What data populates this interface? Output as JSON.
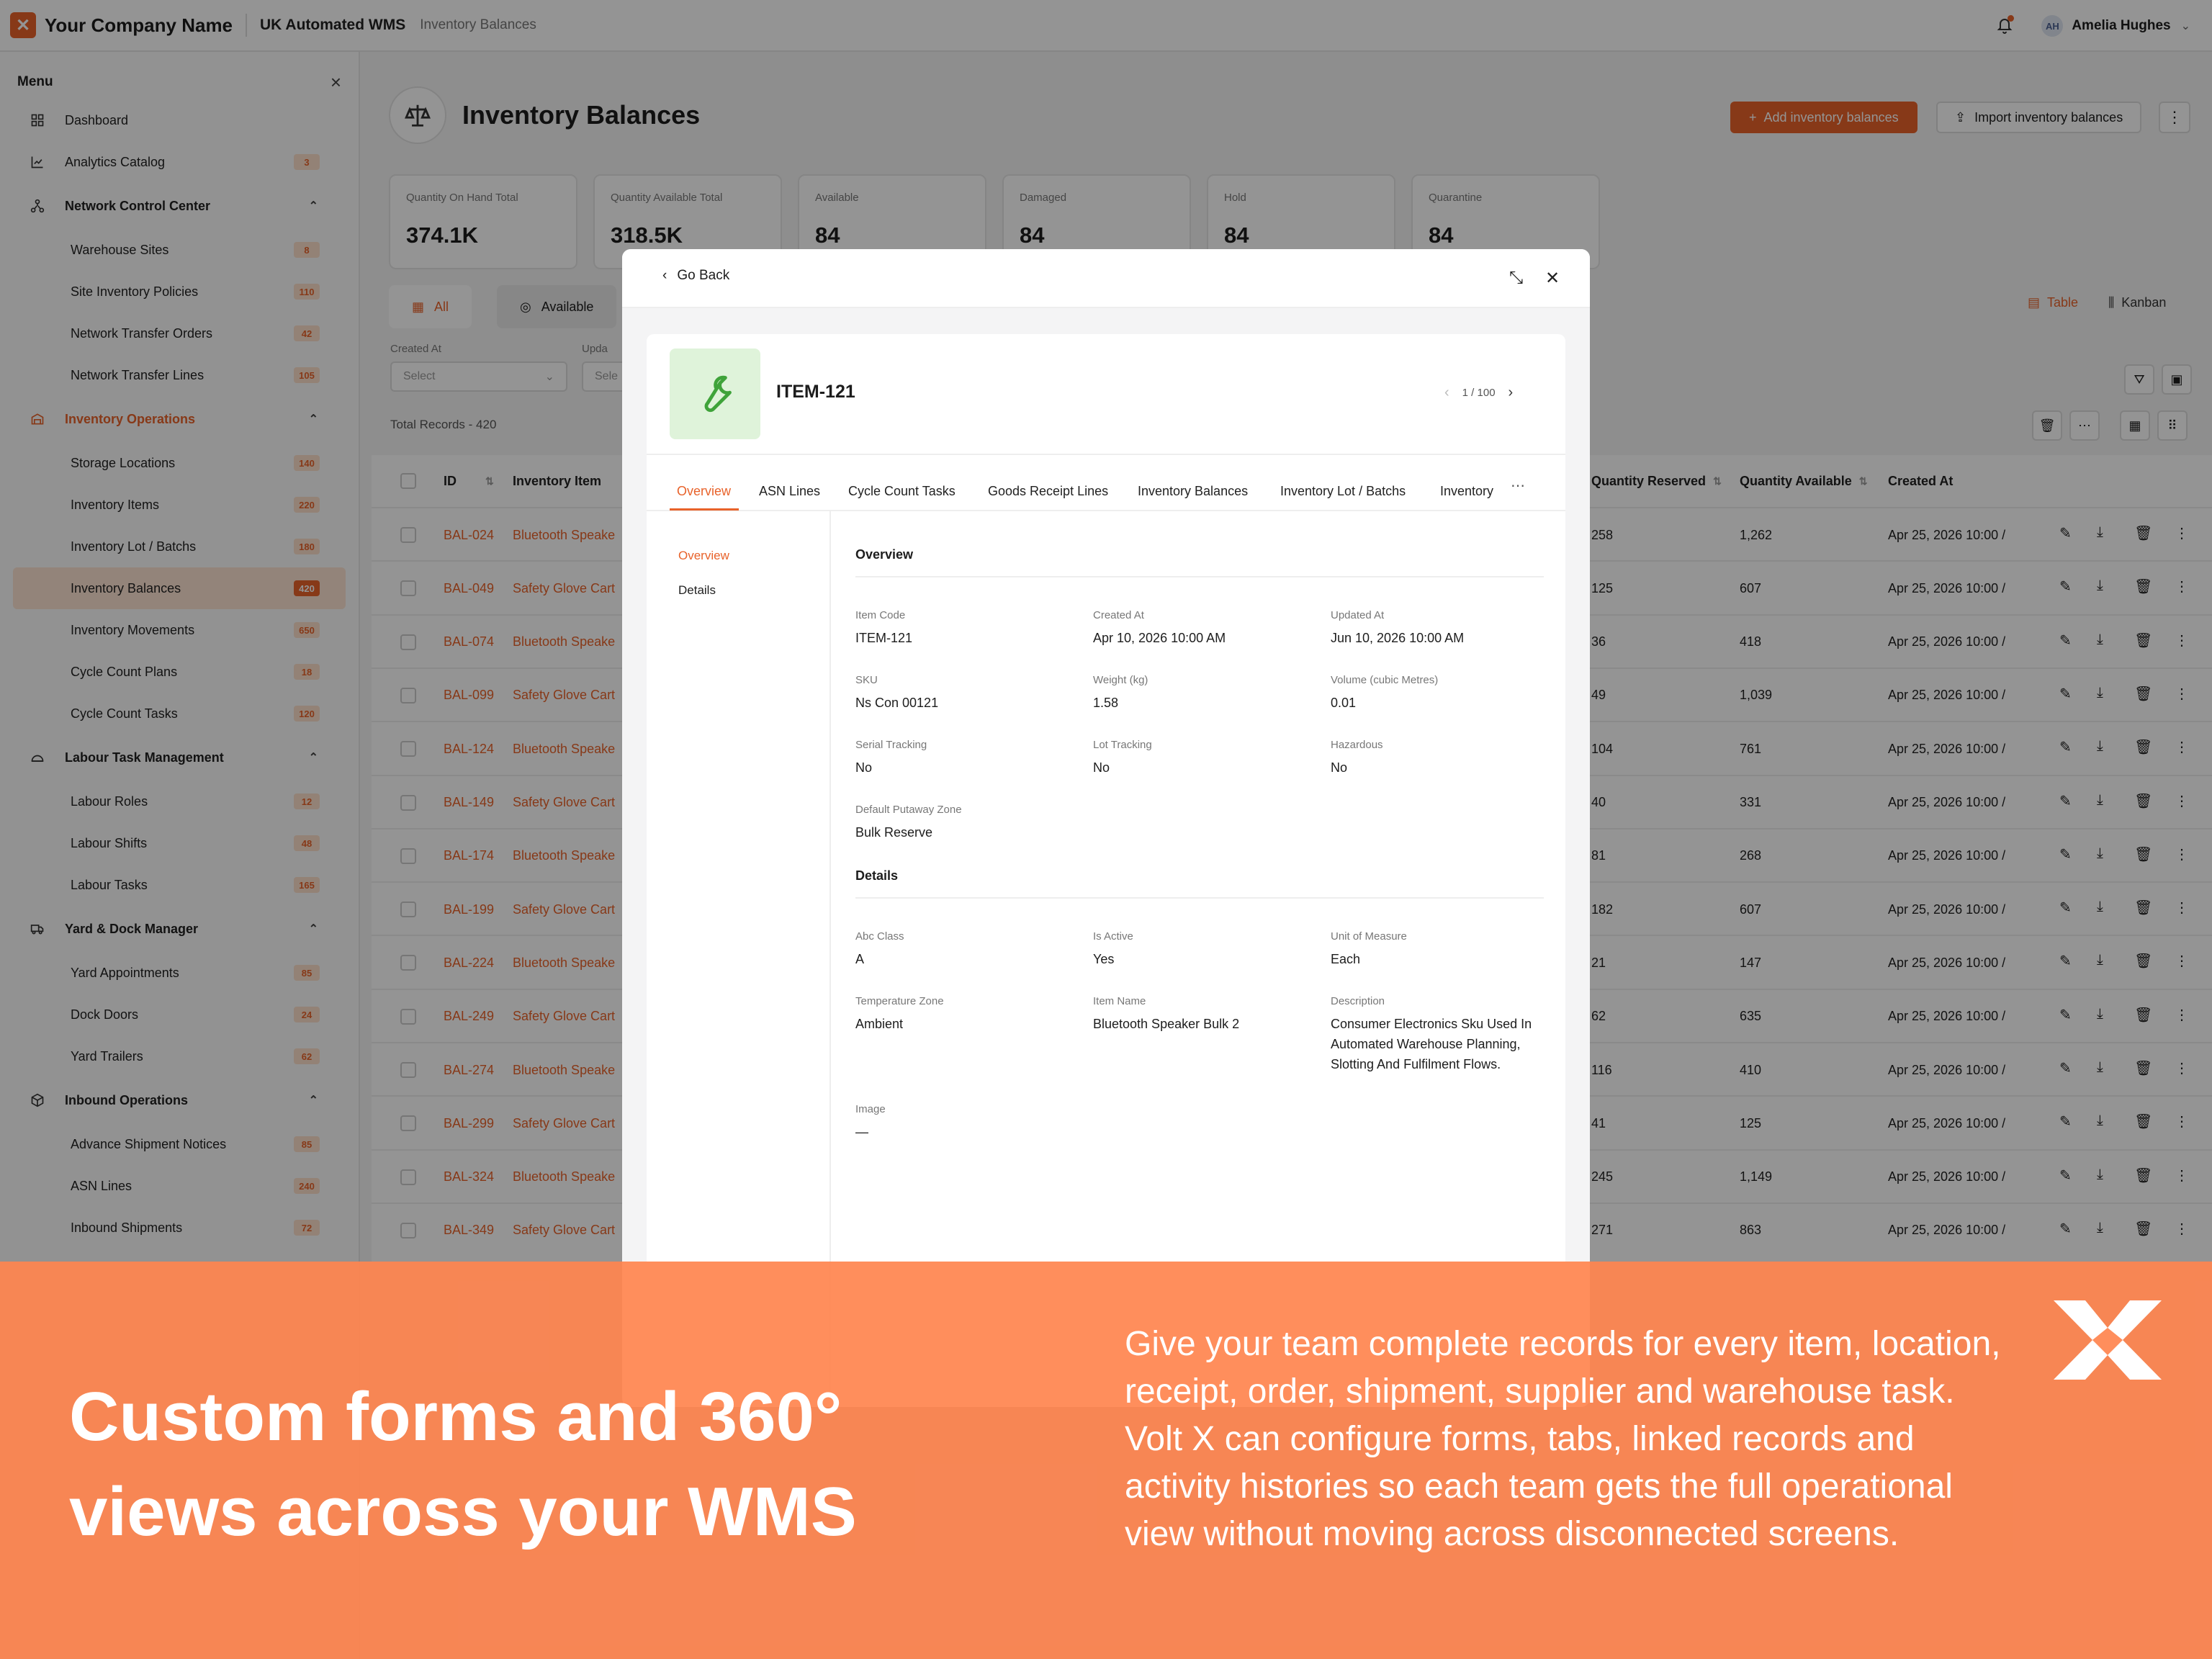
{
  "topbar": {
    "company": "Your Company Name",
    "app": "UK Automated WMS",
    "crumb": "Inventory Balances",
    "user_initials": "AH",
    "user_name": "Amelia Hughes"
  },
  "sidebar": {
    "title": "Menu",
    "items": [
      {
        "label": "Dashboard",
        "kind": "top",
        "icon": "grid-icon"
      },
      {
        "label": "Analytics Catalog",
        "kind": "top",
        "icon": "chart-icon",
        "badge": "3"
      },
      {
        "label": "Network Control Center",
        "kind": "group",
        "icon": "network-icon"
      },
      {
        "label": "Warehouse Sites",
        "kind": "sub",
        "badge": "8"
      },
      {
        "label": "Site Inventory Policies",
        "kind": "sub",
        "badge": "110"
      },
      {
        "label": "Network Transfer Orders",
        "kind": "sub",
        "badge": "42"
      },
      {
        "label": "Network Transfer Lines",
        "kind": "sub",
        "badge": "105"
      },
      {
        "label": "Inventory Operations",
        "kind": "group-active",
        "icon": "warehouse-icon"
      },
      {
        "label": "Storage Locations",
        "kind": "sub",
        "badge": "140"
      },
      {
        "label": "Inventory Items",
        "kind": "sub",
        "badge": "220"
      },
      {
        "label": "Inventory Lot / Batchs",
        "kind": "sub",
        "badge": "180"
      },
      {
        "label": "Inventory Balances",
        "kind": "sub-selected",
        "badge": "420"
      },
      {
        "label": "Inventory Movements",
        "kind": "sub",
        "badge": "650"
      },
      {
        "label": "Cycle Count Plans",
        "kind": "sub",
        "badge": "18"
      },
      {
        "label": "Cycle Count Tasks",
        "kind": "sub",
        "badge": "120"
      },
      {
        "label": "Labour Task Management",
        "kind": "group",
        "icon": "people-icon"
      },
      {
        "label": "Labour Roles",
        "kind": "sub",
        "badge": "12"
      },
      {
        "label": "Labour Shifts",
        "kind": "sub",
        "badge": "48"
      },
      {
        "label": "Labour Tasks",
        "kind": "sub",
        "badge": "165"
      },
      {
        "label": "Yard & Dock Manager",
        "kind": "group",
        "icon": "truck-icon"
      },
      {
        "label": "Yard Appointments",
        "kind": "sub",
        "badge": "85"
      },
      {
        "label": "Dock Doors",
        "kind": "sub",
        "badge": "24"
      },
      {
        "label": "Yard Trailers",
        "kind": "sub",
        "badge": "62"
      },
      {
        "label": "Inbound Operations",
        "kind": "group",
        "icon": "box-icon"
      },
      {
        "label": "Advance Shipment Notices",
        "kind": "sub",
        "badge": "85"
      },
      {
        "label": "ASN Lines",
        "kind": "sub",
        "badge": "240"
      },
      {
        "label": "Inbound Shipments",
        "kind": "sub",
        "badge": "72"
      }
    ]
  },
  "page": {
    "title": "Inventory Balances",
    "add_label": "Add inventory balances",
    "import_label": "Import inventory balances",
    "stats": [
      {
        "label": "Quantity On Hand Total",
        "value": "374.1K"
      },
      {
        "label": "Quantity Available Total",
        "value": "318.5K"
      },
      {
        "label": "Available",
        "value": "84"
      },
      {
        "label": "Damaged",
        "value": "84"
      },
      {
        "label": "Hold",
        "value": "84"
      },
      {
        "label": "Quarantine",
        "value": "84"
      }
    ],
    "filter_tabs": [
      "All",
      "Available"
    ],
    "views": [
      "Table",
      "Kanban"
    ],
    "filters": [
      {
        "label": "Created At",
        "placeholder": "Select"
      },
      {
        "label": "Upda",
        "placeholder": "Sele"
      }
    ],
    "total": "Total Records - 420"
  },
  "table": {
    "headers": {
      "id": "ID",
      "item": "Inventory Item",
      "reserved": "Quantity Reserved",
      "available": "Quantity Available",
      "created": "Created At"
    },
    "rows": [
      {
        "id": "BAL-024",
        "item": "Bluetooth Speake",
        "reserved": "258",
        "available": "1,262",
        "created": "Apr 25, 2026 10:00 /"
      },
      {
        "id": "BAL-049",
        "item": "Safety Glove Cart",
        "reserved": "125",
        "available": "607",
        "created": "Apr 25, 2026 10:00 /"
      },
      {
        "id": "BAL-074",
        "item": "Bluetooth Speake",
        "reserved": "36",
        "available": "418",
        "created": "Apr 25, 2026 10:00 /"
      },
      {
        "id": "BAL-099",
        "item": "Safety Glove Cart",
        "reserved": "49",
        "available": "1,039",
        "created": "Apr 25, 2026 10:00 /"
      },
      {
        "id": "BAL-124",
        "item": "Bluetooth Speake",
        "reserved": "104",
        "available": "761",
        "created": "Apr 25, 2026 10:00 /"
      },
      {
        "id": "BAL-149",
        "item": "Safety Glove Cart",
        "reserved": "40",
        "available": "331",
        "created": "Apr 25, 2026 10:00 /"
      },
      {
        "id": "BAL-174",
        "item": "Bluetooth Speake",
        "reserved": "81",
        "available": "268",
        "created": "Apr 25, 2026 10:00 /"
      },
      {
        "id": "BAL-199",
        "item": "Safety Glove Cart",
        "reserved": "182",
        "available": "607",
        "created": "Apr 25, 2026 10:00 /"
      },
      {
        "id": "BAL-224",
        "item": "Bluetooth Speake",
        "reserved": "21",
        "available": "147",
        "created": "Apr 25, 2026 10:00 /"
      },
      {
        "id": "BAL-249",
        "item": "Safety Glove Cart",
        "reserved": "62",
        "available": "635",
        "created": "Apr 25, 2026 10:00 /"
      },
      {
        "id": "BAL-274",
        "item": "Bluetooth Speake",
        "reserved": "116",
        "available": "410",
        "created": "Apr 25, 2026 10:00 /"
      },
      {
        "id": "BAL-299",
        "item": "Safety Glove Cart",
        "reserved": "41",
        "available": "125",
        "created": "Apr 25, 2026 10:00 /"
      },
      {
        "id": "BAL-324",
        "item": "Bluetooth Speake",
        "reserved": "245",
        "available": "1,149",
        "created": "Apr 25, 2026 10:00 /"
      },
      {
        "id": "BAL-349",
        "item": "Safety Glove Cart",
        "reserved": "271",
        "available": "863",
        "created": "Apr 25, 2026 10:00 /"
      }
    ]
  },
  "modal": {
    "back_label": "Go Back",
    "item_title": "ITEM-121",
    "pager": "1 / 100",
    "tabs": [
      "Overview",
      "ASN Lines",
      "Cycle Count Tasks",
      "Goods Receipt Lines",
      "Inventory Balances",
      "Inventory Lot / Batchs",
      "Inventory"
    ],
    "left_nav": [
      "Overview",
      "Details"
    ],
    "overview_title": "Overview",
    "overview_fields": [
      {
        "label": "Item Code",
        "value": "ITEM-121"
      },
      {
        "label": "Created At",
        "value": "Apr 10, 2026 10:00 AM"
      },
      {
        "label": "Updated At",
        "value": "Jun 10, 2026 10:00 AM"
      },
      {
        "label": "SKU",
        "value": "Ns Con 00121"
      },
      {
        "label": "Weight (kg)",
        "value": "1.58"
      },
      {
        "label": "Volume (cubic Metres)",
        "value": "0.01"
      },
      {
        "label": "Serial Tracking",
        "value": "No"
      },
      {
        "label": "Lot Tracking",
        "value": "No"
      },
      {
        "label": "Hazardous",
        "value": "No"
      },
      {
        "label": "Default Putaway Zone",
        "value": "Bulk Reserve"
      }
    ],
    "details_title": "Details",
    "details_fields": [
      {
        "label": "Abc Class",
        "value": "A"
      },
      {
        "label": "Is Active",
        "value": "Yes"
      },
      {
        "label": "Unit of Measure",
        "value": "Each"
      },
      {
        "label": "Temperature Zone",
        "value": "Ambient"
      },
      {
        "label": "Item Name",
        "value": "Bluetooth Speaker Bulk 2"
      },
      {
        "label": "Description",
        "value": "Consumer Electronics Sku Used In Automated Warehouse Planning, Slotting And Fulfilment Flows."
      },
      {
        "label": "Image",
        "value": "—"
      }
    ]
  },
  "banner": {
    "title": "Custom forms and 360° views across your WMS",
    "text": "Give your team complete records for every item, location, receipt, order, shipment, supplier and warehouse task. Volt X can configure forms, tabs, linked records and activity histories so each team gets the full operational view without moving across disconnected screens."
  },
  "colors": {
    "accent": "#e8622a",
    "banner": "#ff8550"
  }
}
